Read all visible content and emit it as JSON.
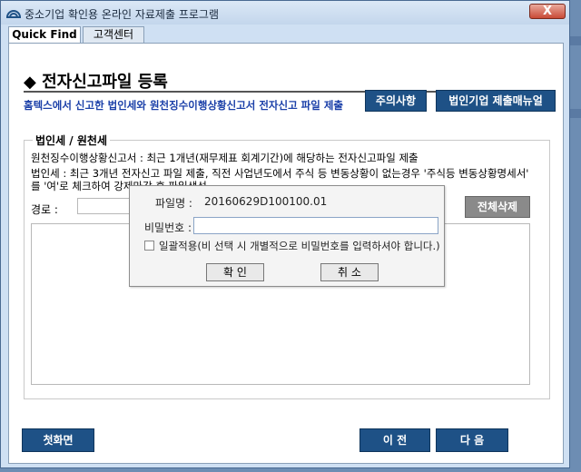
{
  "window": {
    "title": "중소기업 확인용 온라인 자료제출 프로그램",
    "close_label": "X"
  },
  "tabs": [
    {
      "label": "Quick Find",
      "active": true
    },
    {
      "label": "고객센터",
      "active": false
    }
  ],
  "page": {
    "title": "◆ 전자신고파일 등록",
    "subtitle": "홈텍스에서 신고한 법인세와 원천징수이행상황신고서 전자신고 파일 제출",
    "notice_button": "주의사항",
    "manual_button": "법인기업 제출매뉴얼"
  },
  "group": {
    "label": "법인세 / 원천세",
    "info_line1": "원천징수이행상황신고서 : 최근 1개년(재무제표 회계기간)에 해당하는 전자신고파일 제출",
    "info_line2": "법인세 : 최근 3개년 전자신고 파일 제출, 직전 사업년도에서 주식 등 변동상황이 없는경우 '주식등 변동상황명세서'",
    "info_line3": "를 '여'로 체크하여 강제마감 후 파일생성",
    "path_label": "경로 :",
    "path_value": "",
    "delete_all_button": "전체삭제"
  },
  "dialog": {
    "filename_label": "파일명 :",
    "filename_value": "20160629D100100.01",
    "password_label": "비밀번호 :",
    "password_value": "",
    "batch_checkbox_label": "일괄적용(비 선택 시 개별적으로 비밀번호를 입력하셔야 합니다.)",
    "batch_checked": false,
    "ok_button": "확 인",
    "cancel_button": "취 소"
  },
  "footer": {
    "home_button": "첫화면",
    "prev_button": "이 전",
    "next_button": "다 음"
  },
  "colors": {
    "navy_button": "#1e5186",
    "subtitle_blue": "#1a3fa8",
    "window_bg": "#cfe0f3",
    "close_red": "#c94a36"
  }
}
